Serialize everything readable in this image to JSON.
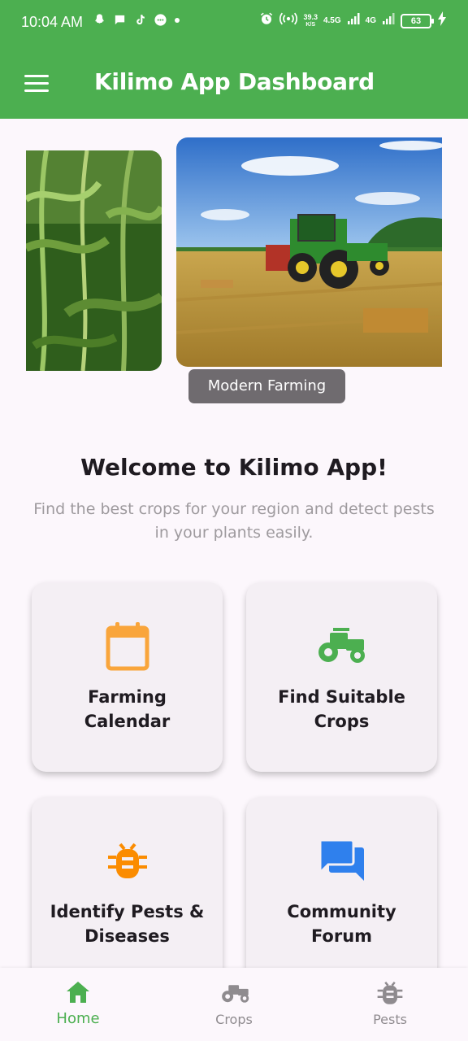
{
  "status_bar": {
    "time": "10:04 AM",
    "net_speed_value": "39.3",
    "net_speed_unit": "K/S",
    "network_1": "4.5G",
    "network_2": "4G",
    "battery": "63"
  },
  "app_bar": {
    "title": "Kilimo App Dashboard"
  },
  "carousel": {
    "caption": "Modern Farming"
  },
  "welcome": {
    "title": "Welcome to Kilimo App!",
    "subtitle": "Find the best crops for your region and detect pests in your plants easily."
  },
  "cards": [
    {
      "label_line1": "Farming",
      "label_line2": "Calendar",
      "icon": "calendar-icon",
      "color": "#f9a53b"
    },
    {
      "label_line1": "Find Suitable",
      "label_line2": "Crops",
      "icon": "tractor-icon",
      "color": "#4caf50"
    },
    {
      "label_line1": "Identify Pests &",
      "label_line2": "Diseases",
      "icon": "bug-icon",
      "color": "#fb8c00"
    },
    {
      "label_line1": "Community",
      "label_line2": "Forum",
      "icon": "forum-icon",
      "color": "#2f80ed"
    }
  ],
  "bottom_nav": {
    "items": [
      {
        "label": "Home",
        "icon": "home-icon",
        "active": true
      },
      {
        "label": "Crops",
        "icon": "tractor-icon",
        "active": false
      },
      {
        "label": "Pests",
        "icon": "bug-icon",
        "active": false
      }
    ]
  },
  "colors": {
    "primary": "#4caf50",
    "background": "#fcf7fc",
    "card": "#f4eff4",
    "caption_bg": "#6f6b6f"
  }
}
